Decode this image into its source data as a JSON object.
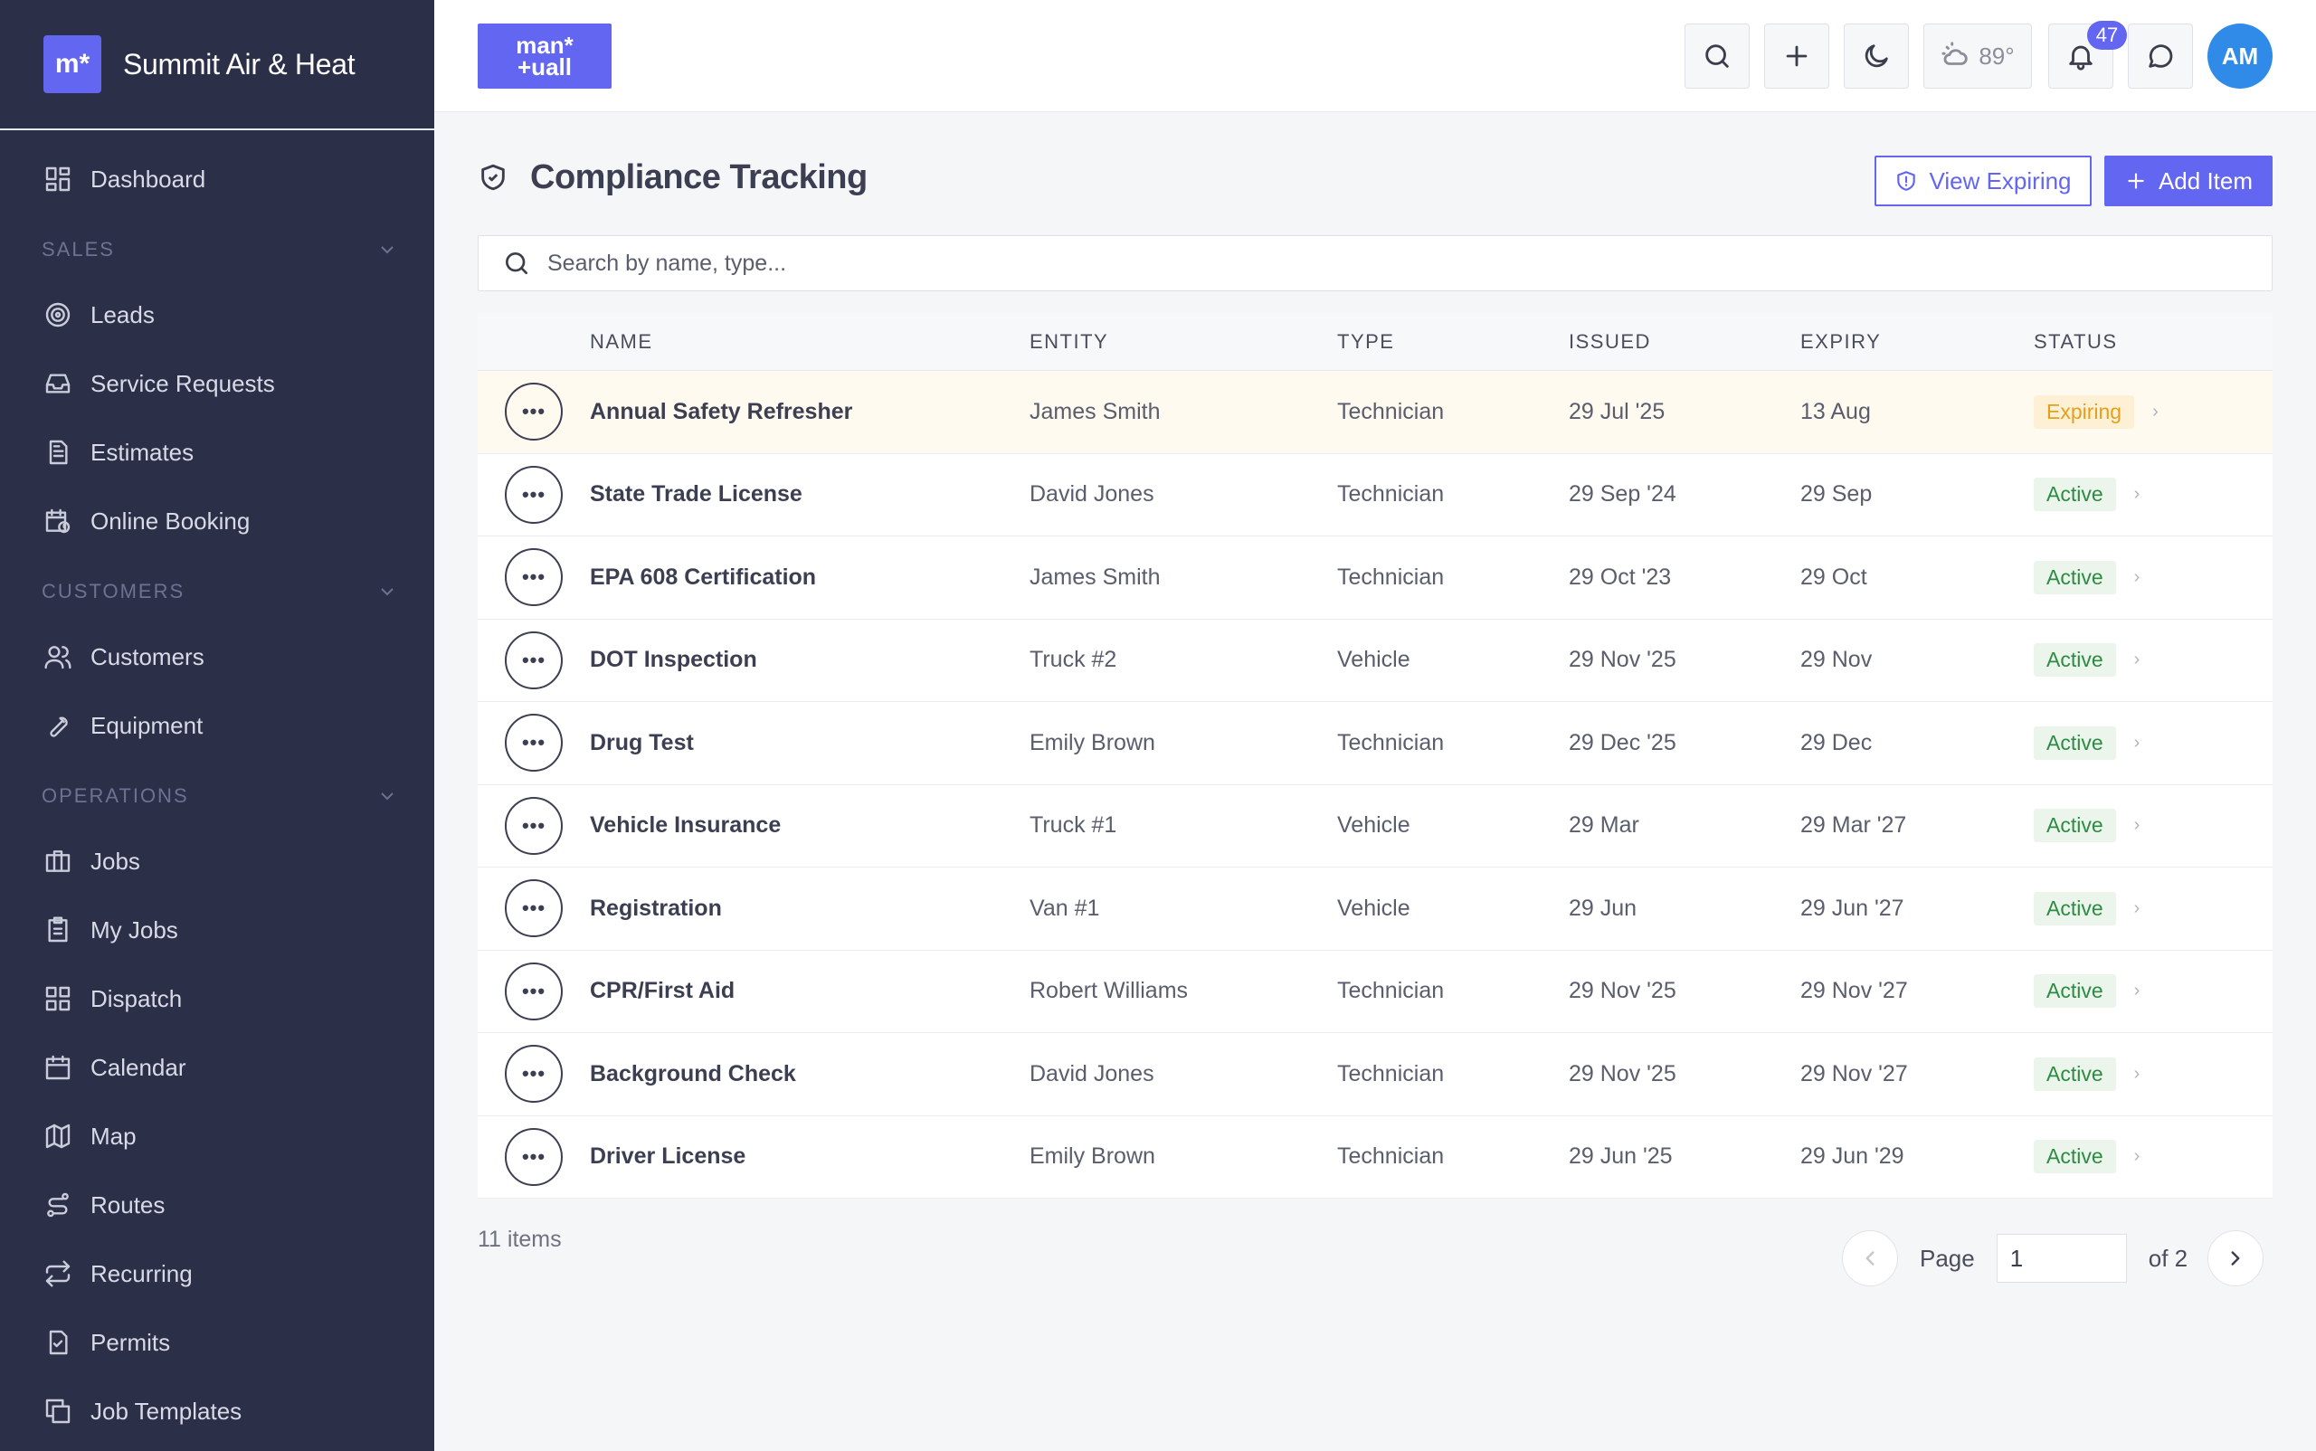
{
  "brand": {
    "logo": "m*",
    "name": "Summit Air & Heat"
  },
  "sidebar": {
    "dashboard": "Dashboard",
    "sections": [
      {
        "title": "SALES",
        "items": [
          "Leads",
          "Service Requests",
          "Estimates",
          "Online Booking"
        ]
      },
      {
        "title": "CUSTOMERS",
        "items": [
          "Customers",
          "Equipment"
        ]
      },
      {
        "title": "OPERATIONS",
        "items": [
          "Jobs",
          "My Jobs",
          "Dispatch",
          "Calendar",
          "Map",
          "Routes",
          "Recurring",
          "Permits",
          "Job Templates"
        ]
      }
    ]
  },
  "topbar": {
    "logo_line1": "man*",
    "logo_line2": "+uall",
    "weather": "89°",
    "notifications": "47",
    "avatar": "AM"
  },
  "page": {
    "title": "Compliance Tracking",
    "view_expiring": "View Expiring",
    "add_item": "Add Item",
    "search_placeholder": "Search by name, type..."
  },
  "table": {
    "columns": [
      "NAME",
      "ENTITY",
      "TYPE",
      "ISSUED",
      "EXPIRY",
      "STATUS"
    ],
    "rows": [
      {
        "name": "Annual Safety Refresher",
        "entity": "James Smith",
        "type": "Technician",
        "issued": "29 Jul '25",
        "expiry": "13 Aug",
        "status": "Expiring"
      },
      {
        "name": "State Trade License",
        "entity": "David Jones",
        "type": "Technician",
        "issued": "29 Sep '24",
        "expiry": "29 Sep",
        "status": "Active"
      },
      {
        "name": "EPA 608 Certification",
        "entity": "James Smith",
        "type": "Technician",
        "issued": "29 Oct '23",
        "expiry": "29 Oct",
        "status": "Active"
      },
      {
        "name": "DOT Inspection",
        "entity": "Truck #2",
        "type": "Vehicle",
        "issued": "29 Nov '25",
        "expiry": "29 Nov",
        "status": "Active"
      },
      {
        "name": "Drug Test",
        "entity": "Emily Brown",
        "type": "Technician",
        "issued": "29 Dec '25",
        "expiry": "29 Dec",
        "status": "Active"
      },
      {
        "name": "Vehicle Insurance",
        "entity": "Truck #1",
        "type": "Vehicle",
        "issued": "29 Mar",
        "expiry": "29 Mar '27",
        "status": "Active"
      },
      {
        "name": "Registration",
        "entity": "Van #1",
        "type": "Vehicle",
        "issued": "29 Jun",
        "expiry": "29 Jun '27",
        "status": "Active"
      },
      {
        "name": "CPR/First Aid",
        "entity": "Robert Williams",
        "type": "Technician",
        "issued": "29 Nov '25",
        "expiry": "29 Nov '27",
        "status": "Active"
      },
      {
        "name": "Background Check",
        "entity": "David Jones",
        "type": "Technician",
        "issued": "29 Nov '25",
        "expiry": "29 Nov '27",
        "status": "Active"
      },
      {
        "name": "Driver License",
        "entity": "Emily Brown",
        "type": "Technician",
        "issued": "29 Jun '25",
        "expiry": "29 Jun '29",
        "status": "Active"
      }
    ]
  },
  "footer": {
    "count": "11 items",
    "page_label": "Page",
    "page_value": "1",
    "of_label": "of 2"
  },
  "colors": {
    "accent": "#6366f1",
    "sidebar_bg": "#2c2f48",
    "active": "#2e8b43",
    "expiring": "#e3a01c",
    "avatar": "#2f8ae8"
  }
}
